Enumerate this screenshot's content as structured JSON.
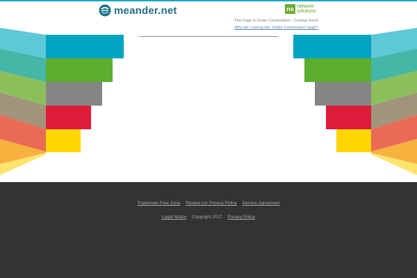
{
  "header": {
    "logo_text": "meander.net",
    "partner_logo": {
      "badge": "ns",
      "line1": "network",
      "line2": "solutions"
    },
    "notice_text": "This Page is Under Construction - Coming Soon!",
    "notice_link": "Why am I seeing this 'Under Construction' page?"
  },
  "footer": {
    "links_row1": [
      "Trademark Free Zone",
      "Review our Privacy Policy",
      "Service Agreement"
    ],
    "legal_notice": "Legal Notice",
    "copyright": "Copyright 2017",
    "privacy_policy": "Privacy Policy"
  },
  "colors": {
    "accent": "#1aa6c4",
    "footer_bg": "#333333",
    "bar_colors": [
      "#00a4c2",
      "#5cad30",
      "#858585",
      "#df1b3a",
      "#ffd600"
    ]
  },
  "icons": [
    "meander-logo-icon",
    "network-solutions-badge-icon"
  ]
}
